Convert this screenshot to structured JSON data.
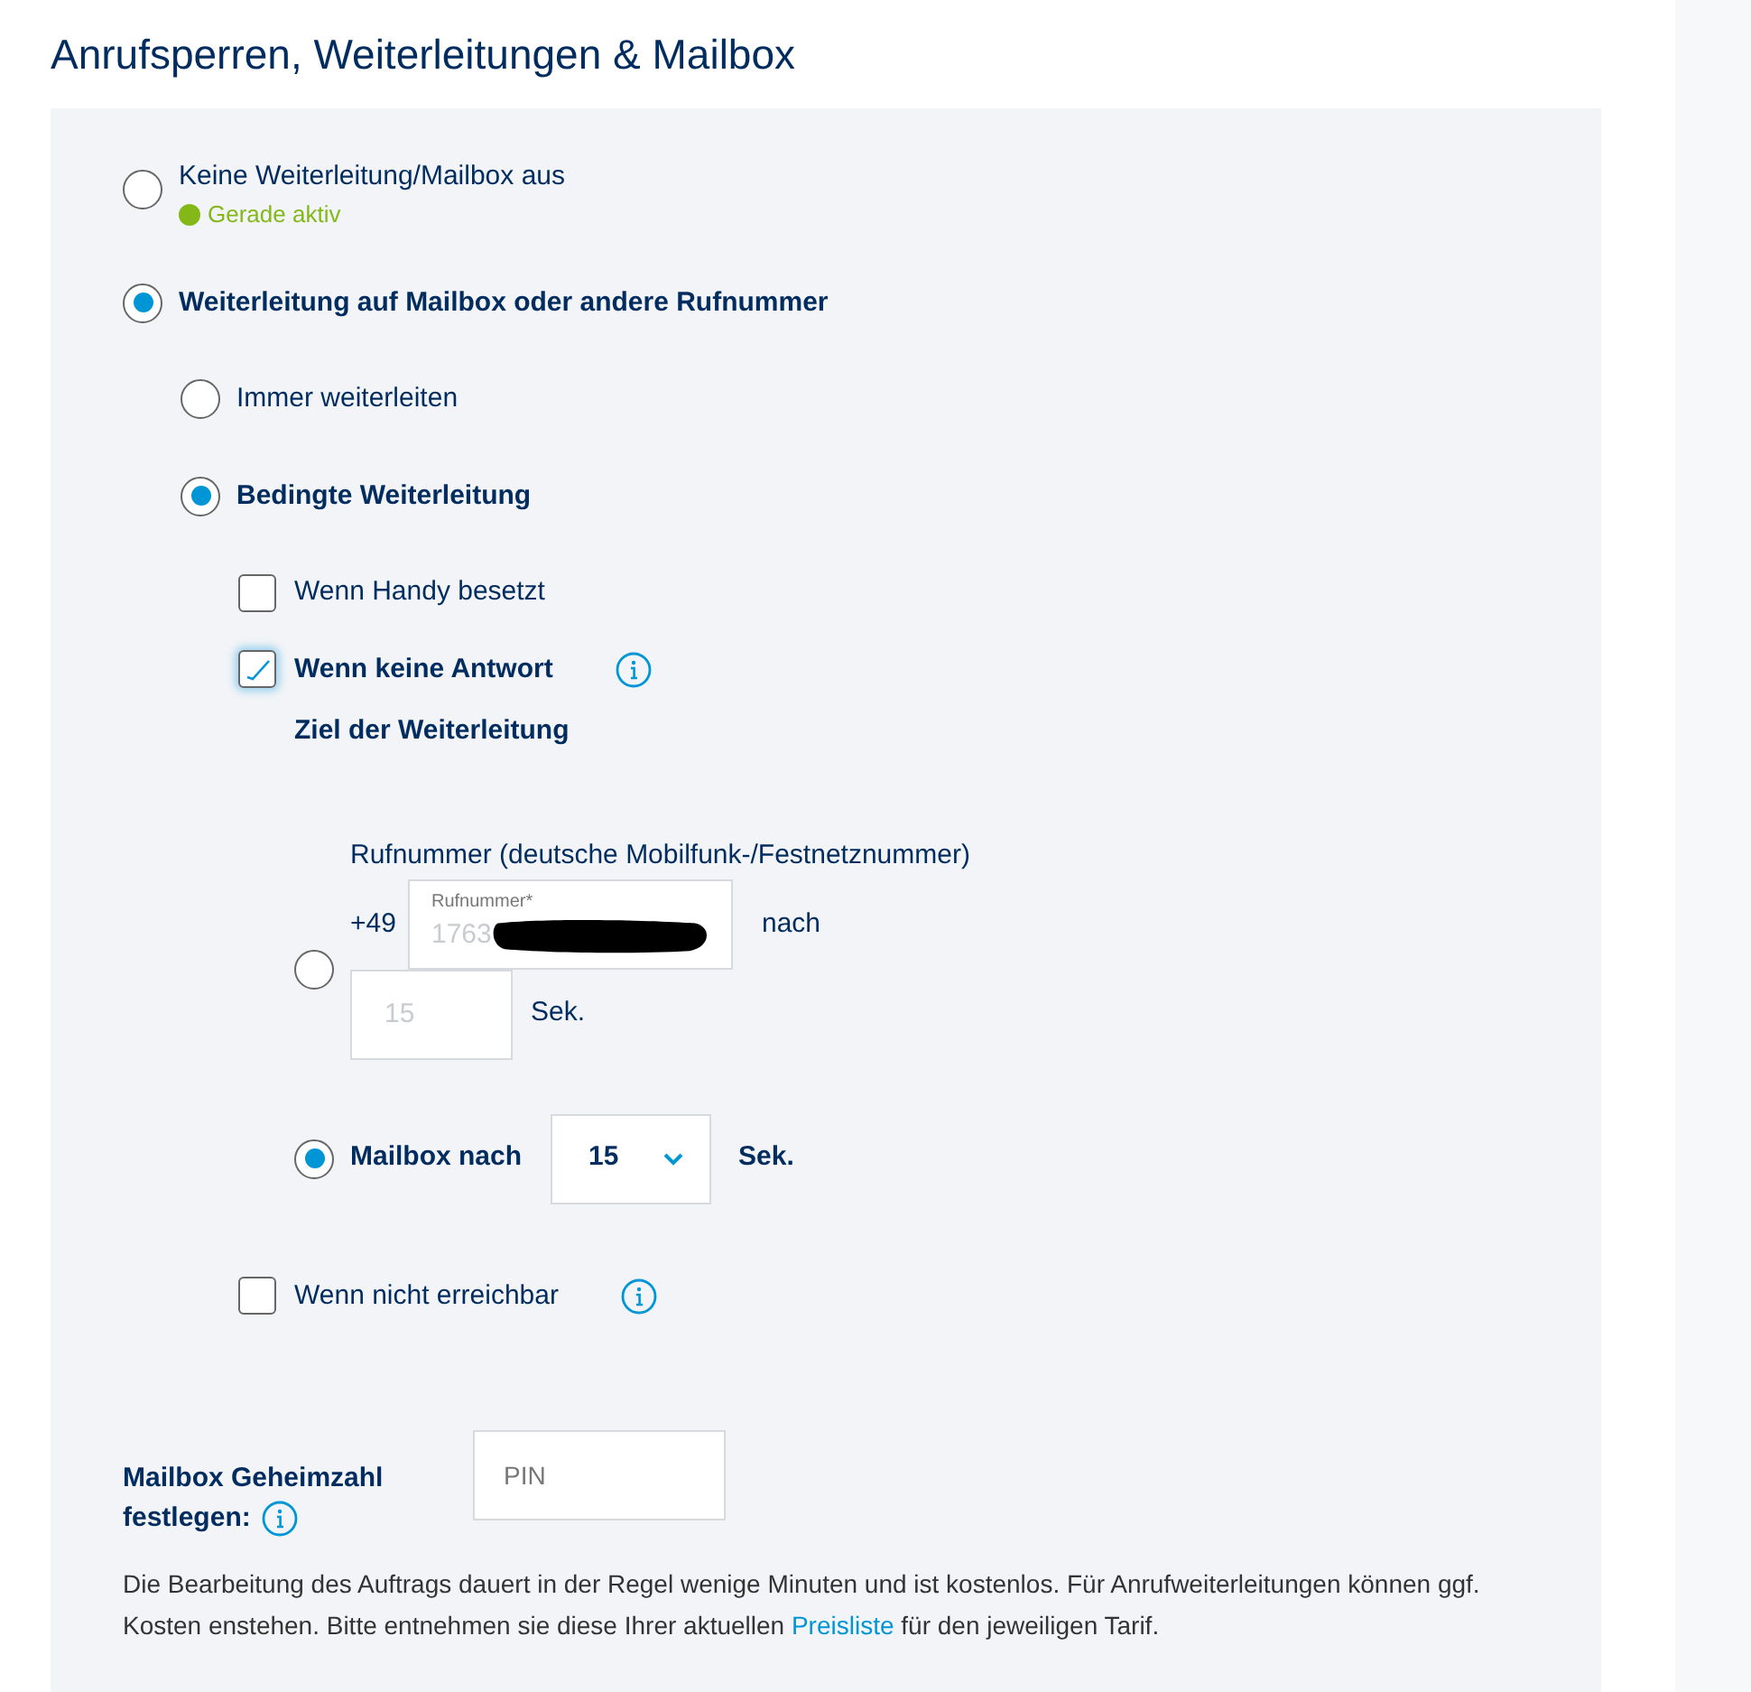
{
  "title": "Anrufsperren, Weiterleitungen & Mailbox",
  "modes": [
    {
      "label": "Keine Weiterleitung/Mailbox aus",
      "selected": false,
      "status": {
        "text": "Gerade aktiv",
        "color": "#84b819"
      }
    },
    {
      "label": "Weiterleitung auf Mailbox oder andere Rufnummer",
      "selected": true,
      "children": [
        {
          "label": "Immer weiterleiten",
          "selected": false
        },
        {
          "label": "Bedingte Weiterleitung",
          "selected": true,
          "conditions": [
            {
              "label": "Wenn Handy besetzt",
              "checked": false,
              "info": false
            },
            {
              "label": "Wenn keine Antwort",
              "checked": true,
              "info": true,
              "target": {
                "heading": "Ziel der Weiterleitung",
                "options": [
                  {
                    "kind": "number",
                    "selected": false,
                    "label": "Rufnummer (deutsche Mobilfunk-/Festnetznummer)",
                    "prefix": "+49",
                    "field_label": "Rufnummer*",
                    "value": "1763",
                    "after": "nach",
                    "seconds": "15",
                    "unit": "Sek."
                  },
                  {
                    "kind": "mailbox",
                    "selected": true,
                    "label": "Mailbox nach",
                    "value": "15",
                    "unit": "Sek."
                  }
                ]
              }
            },
            {
              "label": "Wenn nicht erreichbar",
              "checked": false,
              "info": true
            }
          ]
        }
      ]
    }
  ],
  "pin": {
    "label_lines": [
      "Mailbox Geheimzahl",
      "festlegen:"
    ],
    "info": true,
    "placeholder": "PIN"
  },
  "note": {
    "before": "Die Bearbeitung des Auftrags dauert in der Regel wenige Minuten und ist kostenlos. Für Anrufweiterleitungen können ggf. Kosten enstehen. Bitte entnehmen sie diese Ihrer aktuellen ",
    "link": "Preisliste",
    "after": " für den jeweiligen Tarif."
  }
}
